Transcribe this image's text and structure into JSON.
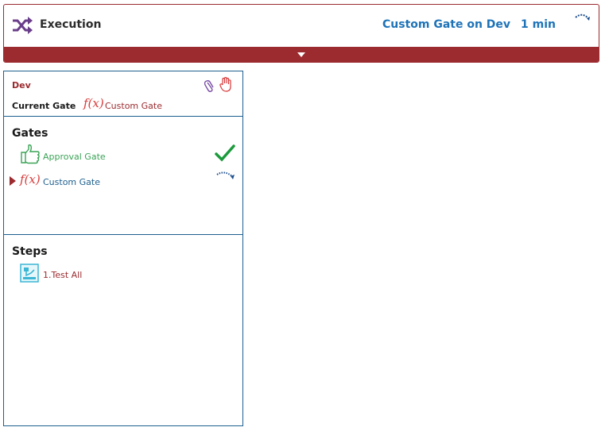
{
  "header": {
    "title": "Execution",
    "gate_status": "Custom Gate on Dev",
    "duration": "1 min",
    "brand_color": "#9c2b2f",
    "accent_color": "#1e73b8",
    "icons": {
      "execution": "shuffle-icon",
      "progress": "spinner-icon",
      "expand": "chevron-down-icon"
    }
  },
  "environment": {
    "name": "Dev",
    "current_gate_label": "Current Gate",
    "current_gate_icon": "f(x)",
    "current_gate_name": "Custom Gate",
    "icons": [
      "paperclip-icon",
      "hand-stop-icon"
    ]
  },
  "gates": {
    "title": "Gates",
    "items": [
      {
        "icon": "thumbs-up-icon",
        "name": "Approval Gate",
        "status": "completed",
        "status_icon": "checkmark-icon"
      },
      {
        "icon": "f(x)",
        "name": "Custom Gate",
        "status": "in-progress",
        "status_icon": "spinner-icon",
        "current": true
      }
    ]
  },
  "steps": {
    "title": "Steps",
    "items": [
      {
        "icon": "robot-step-icon",
        "name": "1.Test All"
      }
    ]
  }
}
